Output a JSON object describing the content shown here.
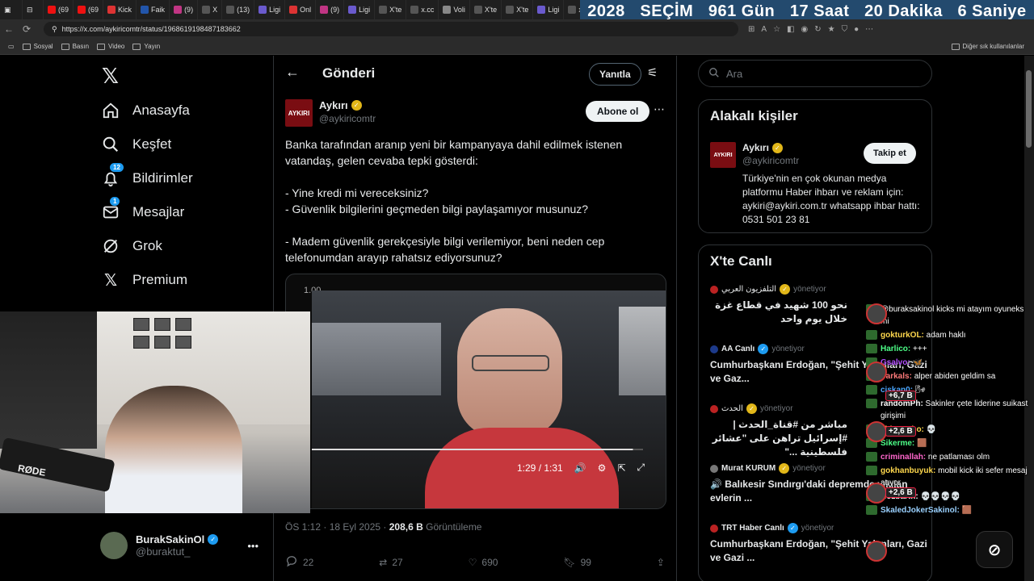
{
  "browser": {
    "tabs": [
      {
        "label": "(69",
        "color": "#e11"
      },
      {
        "label": "(69",
        "color": "#e11"
      },
      {
        "label": "Kick",
        "color": "#d33"
      },
      {
        "label": "Faik",
        "color": "#2255aa"
      },
      {
        "label": "(9)",
        "color": "#c13584"
      },
      {
        "label": "X",
        "color": "#555"
      },
      {
        "label": "(13)",
        "color": "#555"
      },
      {
        "label": "Ligi",
        "color": "#6a5acd"
      },
      {
        "label": "Onl",
        "color": "#d33"
      },
      {
        "label": "(9)",
        "color": "#c13584"
      },
      {
        "label": "Ligi",
        "color": "#6a5acd"
      },
      {
        "label": "X'te",
        "color": "#555"
      },
      {
        "label": "x.cc",
        "color": "#555"
      },
      {
        "label": "Voli",
        "color": "#888"
      },
      {
        "label": "X'te",
        "color": "#555"
      },
      {
        "label": "X'te",
        "color": "#555"
      },
      {
        "label": "Ligi",
        "color": "#6a5acd"
      },
      {
        "label": "x.cc",
        "color": "#555"
      }
    ],
    "url": "https://x.com/aykiricomtr/status/1968619198487183662",
    "bookmarks": [
      "Sosyal",
      "Basın",
      "Video",
      "Yayın"
    ],
    "bookmarks_other": "Diğer sık kullanılanlar"
  },
  "countdown": {
    "year": "2028",
    "label": "SEÇİM",
    "days": "961 Gün",
    "hours": "17 Saat",
    "minutes": "20 Dakika",
    "seconds": "6  Saniye"
  },
  "leftnav": {
    "items": [
      {
        "label": "Anasayfa",
        "icon": "home-icon"
      },
      {
        "label": "Keşfet",
        "icon": "search-icon"
      },
      {
        "label": "Bildirimler",
        "icon": "bell-icon",
        "badge": "12"
      },
      {
        "label": "Mesajlar",
        "icon": "mail-icon",
        "badge": "1"
      },
      {
        "label": "Grok",
        "icon": "grok-icon"
      },
      {
        "label": "Premium",
        "icon": "x-icon"
      }
    ],
    "profile": {
      "name": "BurakSakinOl",
      "handle": "@buraktut_"
    }
  },
  "post": {
    "header_title": "Gönderi",
    "reply_label": "Yanıtla",
    "author_name": "Aykırı",
    "author_handle": "@aykiricomtr",
    "logo_text": "AYKIRI",
    "follow_label": "Abone ol",
    "text_p1": "Banka tarafından aranıp yeni bir kampanyaya dahil edilmek istenen vatandaş, gelen cevaba tepki gösterdi:",
    "text_p2": "- Yine kredi mi vereceksiniz?",
    "text_p3": "- Güvenlik bilgilerini geçmeden bilgi paylaşamıyor musunuz?",
    "text_p4": "- Madem güvenlik gerekçesiyle bilgi verilemiyor, beni neden cep telefonumdan arayıp rahatsız ediyorsunuz?",
    "video": {
      "speed": "1.00",
      "time": "1:29 / 1:31",
      "progress": 0.97
    },
    "meta_time": "ÖS 1:12 · 18 Eyl 2025 · ",
    "meta_views": "208,6 B",
    "meta_views_label": " Görüntüleme",
    "stats": {
      "replies": "22",
      "reposts": "27",
      "likes": "690",
      "bookmarks": "99"
    }
  },
  "right": {
    "search_placeholder": "Ara",
    "related_title": "Alakalı kişiler",
    "related": {
      "name": "Aykırı",
      "handle": "@aykiricomtr",
      "bio": "Türkiye'nin en çok okunan medya platformu Haber ihbarı ve reklam için: aykiri@aykiri.com.tr whatsapp ihbar hattı: 0531 501 23 81",
      "follow_label": "Takip et",
      "logo_text": "AYKIRI"
    },
    "live_title": "X'te Canlı",
    "live": [
      {
        "source": "التلفزيون العربي",
        "status": "yönetiyor",
        "text": "نحو 100 شهيد في قطاع غزة خلال يوم واحد",
        "rtl": true
      },
      {
        "source": "AA Canlı",
        "status": "yönetiyor",
        "text": "Cumhurbaşkanı Erdoğan, \"Şehit Yakınları, Gazi ve Gaz...",
        "rtl": false
      },
      {
        "source": "الحدث",
        "status": "yönetiyor",
        "text": "مباشر من #قناة_الحدث | #إسرائيل تراهن على \"عشائر فلسطينية ...\"",
        "rtl": true
      },
      {
        "source": "Murat KURUM",
        "status": "yönetiyor",
        "text": "🔊 Balıkesir Sındırgı'daki depremde yıkılan evlerin ...",
        "rtl": false
      },
      {
        "source": "TRT Haber Canlı",
        "status": "yönetiyor",
        "text": "Cumhurbaşkanı Erdoğan, \"Şehit Yakınları, Gazi ve Gazi ...",
        "rtl": false
      }
    ]
  },
  "cam": {
    "mic_brand": "RØDE"
  },
  "chat": {
    "messages": [
      {
        "user": "",
        "text": "@buraksakinol kicks mi atayım oyuneks mi",
        "color": "#ff4d4d"
      },
      {
        "user": "gokturkOL:",
        "text": " adam haklı",
        "color": "#ffd84d"
      },
      {
        "user": "Harlico:",
        "text": " +++",
        "color": "#4dff88"
      },
      {
        "user": "Gsalvo:",
        "text": " 🦋",
        "color": "#b34dff"
      },
      {
        "user": "Parkals:",
        "text": " alper abiden geldim sa",
        "color": "#ff7a7a"
      },
      {
        "user": "ciskan0:",
        "text": " 🌬",
        "color": "#4da6ff"
      },
      {
        "user": "randomPh:",
        "text": " Sakinler çete liderine suikast girişimi",
        "color": "#ffffff"
      },
      {
        "user": "chimentho:",
        "text": " 💀",
        "color": "#ffd84d"
      },
      {
        "user": "Sikerme:",
        "text": " 🟫",
        "color": "#4dff88"
      },
      {
        "user": "criminallah:",
        "text": " ne patlaması olm",
        "color": "#ff66cc"
      },
      {
        "user": "gokhanbuyuk:",
        "text": " mobil kick iki sefer mesaj atıyor",
        "color": "#ffd84d"
      },
      {
        "user": "NozbaRh:",
        "text": " 💀💀💀💀",
        "color": "#ffffff"
      },
      {
        "user": "SkaledJokerSakinol:",
        "text": " 🟫",
        "color": "#9ad1ff"
      }
    ],
    "gifts": [
      "+6,7 B",
      "+2,6 B",
      "+2,6 B"
    ]
  }
}
